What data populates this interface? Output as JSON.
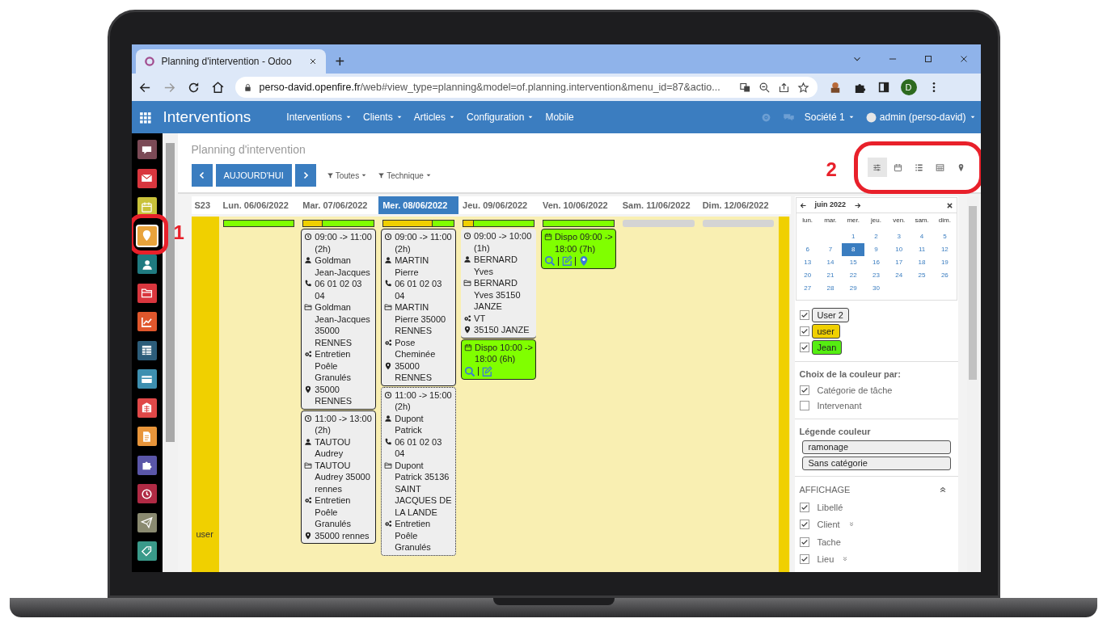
{
  "browser": {
    "tab_title": "Planning d'intervention - Odoo",
    "new_tab": "+",
    "url_host": "perso-david.openfire.fr",
    "url_path": "/web#view_type=planning&model=of.planning.intervention&menu_id=87&actio...",
    "profile_initial": "D"
  },
  "navbar": {
    "app": "Interventions",
    "menus": [
      {
        "label": "Interventions",
        "dropdown": true
      },
      {
        "label": "Clients",
        "dropdown": true
      },
      {
        "label": "Articles",
        "dropdown": true
      },
      {
        "label": "Configuration",
        "dropdown": true
      },
      {
        "label": "Mobile",
        "dropdown": false
      }
    ],
    "company": "Société 1",
    "user": "admin (perso-david)"
  },
  "apps": [
    {
      "kind": "chat",
      "color": "#7b4a56",
      "selected": false
    },
    {
      "kind": "mail",
      "color": "#d9363e",
      "selected": false
    },
    {
      "kind": "calendar",
      "color": "#c9c23a",
      "selected": false
    },
    {
      "kind": "pin",
      "color": "#e8a33c",
      "selected": true
    },
    {
      "kind": "person",
      "color": "#1f7a80",
      "selected": false
    },
    {
      "kind": "folder",
      "color": "#d9363e",
      "selected": false
    },
    {
      "kind": "chart",
      "color": "#e0572c",
      "selected": false
    },
    {
      "kind": "sheet",
      "color": "#2c5d7a",
      "selected": false
    },
    {
      "kind": "card",
      "color": "#3d8fb0",
      "selected": false
    },
    {
      "kind": "building",
      "color": "#e04848",
      "selected": false
    },
    {
      "kind": "doc",
      "color": "#e8953a",
      "selected": false
    },
    {
      "kind": "puzzle",
      "color": "#5a56a8",
      "selected": false
    },
    {
      "kind": "clock",
      "color": "#b02a44",
      "selected": false
    },
    {
      "kind": "plane",
      "color": "#8a8a70",
      "selected": false
    },
    {
      "kind": "tag",
      "color": "#3a9a8a",
      "selected": false
    }
  ],
  "page": {
    "title": "Planning d'intervention",
    "today": "AUJOURD'HUI",
    "filters": [
      "Toutes",
      "Technique"
    ],
    "views": [
      {
        "kind": "settings",
        "selected": true
      },
      {
        "kind": "calendar",
        "selected": false
      },
      {
        "kind": "list",
        "selected": false
      },
      {
        "kind": "table",
        "selected": false
      },
      {
        "kind": "map",
        "selected": false
      }
    ]
  },
  "calendar": {
    "week": "S23",
    "row_label": "user",
    "days": [
      {
        "label": "Lun. 06/06/2022",
        "selected": false,
        "load": {
          "kind": "load",
          "level": 0
        }
      },
      {
        "label": "Mar. 07/06/2022",
        "selected": false,
        "load": {
          "kind": "load",
          "level": 0.27
        },
        "events": [
          {
            "kind": "intervention",
            "lines": [
              {
                "kind": "time",
                "text": "09:00 -> 11:00 (2h)"
              },
              {
                "kind": "client",
                "text": "Goldman Jean-Jacques"
              },
              {
                "kind": "phone",
                "text": "06 01 02 03 04"
              },
              {
                "kind": "address",
                "text": "Goldman Jean-Jacques 35000 RENNES"
              },
              {
                "kind": "task",
                "text": "Entretien Poêle Granulés"
              },
              {
                "kind": "place",
                "text": "35000 RENNES"
              }
            ]
          },
          {
            "kind": "intervention",
            "lines": [
              {
                "kind": "time",
                "text": "11:00 -> 13:00 (2h)"
              },
              {
                "kind": "client",
                "text": "TAUTOU Audrey"
              },
              {
                "kind": "address",
                "text": "TAUTOU Audrey 35000 rennes"
              },
              {
                "kind": "task",
                "text": "Entretien Poêle Granulés"
              },
              {
                "kind": "place",
                "text": "35000 rennes"
              }
            ]
          }
        ]
      },
      {
        "label": "Mer. 08/06/2022",
        "selected": true,
        "load": {
          "kind": "load",
          "level": 0.7
        },
        "events": [
          {
            "kind": "intervention",
            "lines": [
              {
                "kind": "time",
                "text": "09:00 -> 11:00 (2h)"
              },
              {
                "kind": "client",
                "text": "MARTIN Pierre"
              },
              {
                "kind": "phone",
                "text": "06 01 02 03 04"
              },
              {
                "kind": "address",
                "text": "MARTIN Pierre 35000 RENNES"
              },
              {
                "kind": "task",
                "text": "Pose Cheminée"
              },
              {
                "kind": "place",
                "text": "35000 RENNES"
              }
            ]
          },
          {
            "kind": "tentative",
            "lines": [
              {
                "kind": "time",
                "text": "11:00 -> 15:00 (2h)"
              },
              {
                "kind": "client",
                "text": "Dupont Patrick"
              },
              {
                "kind": "phone",
                "text": "06 01 02 03 04"
              },
              {
                "kind": "address",
                "text": "Dupont Patrick 35136 SAINT JACQUES DE LA LANDE"
              },
              {
                "kind": "task",
                "text": "Entretien Poêle Granulés"
              }
            ]
          }
        ]
      },
      {
        "label": "Jeu. 09/06/2022",
        "selected": false,
        "load": {
          "kind": "load",
          "level": 0.15
        },
        "events": [
          {
            "kind": "unframed",
            "lines": [
              {
                "kind": "time",
                "text": "09:00 -> 10:00 (1h)"
              },
              {
                "kind": "client",
                "text": "BERNARD Yves"
              },
              {
                "kind": "address",
                "text": "BERNARD Yves 35150 JANZE"
              },
              {
                "kind": "task",
                "text": "VT"
              },
              {
                "kind": "place",
                "text": "35150 JANZE"
              }
            ]
          },
          {
            "kind": "dispo",
            "text": "Dispo 10:00 -> 18:00 (6h)",
            "actions": [
              {
                "kind": "search"
              },
              {
                "kind": "edit"
              }
            ]
          }
        ]
      },
      {
        "label": "Ven. 10/06/2022",
        "selected": false,
        "load": {
          "kind": "load",
          "level": 0
        },
        "events": [
          {
            "kind": "dispo",
            "text": "Dispo 09:00 -> 18:00 (7h)",
            "actions": [
              {
                "kind": "search"
              },
              {
                "kind": "edit"
              },
              {
                "kind": "pin"
              }
            ]
          }
        ]
      },
      {
        "label": "Sam. 11/06/2022",
        "selected": false,
        "load": {
          "kind": "empty"
        }
      },
      {
        "label": "Dim. 12/06/2022",
        "selected": false,
        "load": {
          "kind": "empty"
        }
      }
    ]
  },
  "panel": {
    "minical": {
      "month": "juin 2022",
      "weekdays": [
        "lun.",
        "mar.",
        "mer.",
        "jeu.",
        "ven.",
        "sam.",
        "dim."
      ],
      "weeks": [
        {
          "days": [
            {
              "label": "1",
              "selected": false
            },
            {
              "label": "2",
              "selected": false
            },
            {
              "label": "3",
              "selected": false
            },
            {
              "label": "4",
              "selected": false
            },
            {
              "label": "5",
              "selected": false
            }
          ]
        },
        {
          "days": [
            {
              "label": "6",
              "selected": false
            },
            {
              "label": "7",
              "selected": false
            },
            {
              "label": "8",
              "selected": true
            },
            {
              "label": "9",
              "selected": false
            },
            {
              "label": "10",
              "selected": false
            },
            {
              "label": "11",
              "selected": false
            },
            {
              "label": "12",
              "selected": false
            }
          ]
        },
        {
          "days": [
            {
              "label": "13",
              "selected": false
            },
            {
              "label": "14",
              "selected": false
            },
            {
              "label": "15",
              "selected": false
            },
            {
              "label": "16",
              "selected": false
            },
            {
              "label": "17",
              "selected": false
            },
            {
              "label": "18",
              "selected": false
            },
            {
              "label": "19",
              "selected": false
            }
          ]
        },
        {
          "days": [
            {
              "label": "20",
              "selected": false
            },
            {
              "label": "21",
              "selected": false
            },
            {
              "label": "22",
              "selected": false
            },
            {
              "label": "23",
              "selected": false
            },
            {
              "label": "24",
              "selected": false
            },
            {
              "label": "25",
              "selected": false
            },
            {
              "label": "26",
              "selected": false
            }
          ]
        },
        {
          "days": [
            {
              "label": "27",
              "selected": false
            },
            {
              "label": "28",
              "selected": false
            },
            {
              "label": "29",
              "selected": false
            },
            {
              "label": "30",
              "selected": false
            }
          ]
        }
      ]
    },
    "users": [
      {
        "label": "User 2",
        "checked": true,
        "color": "#eeeeee"
      },
      {
        "label": "user",
        "checked": true,
        "color": "#f0d000"
      },
      {
        "label": "Jean",
        "checked": true,
        "color": "#55ee11"
      }
    ],
    "color_by": {
      "title": "Choix de la couleur par:",
      "options": [
        {
          "label": "Catégorie de tâche",
          "checked": true
        },
        {
          "label": "Intervenant",
          "checked": false
        }
      ]
    },
    "legend": {
      "title": "Légende couleur",
      "items": [
        "ramonage",
        "Sans catégorie"
      ]
    },
    "display": {
      "title": "AFFICHAGE",
      "expanded": true,
      "items": [
        {
          "label": "Libellé",
          "checked": true,
          "expandable": false
        },
        {
          "label": "Client",
          "checked": true,
          "expandable": true
        },
        {
          "label": "Tache",
          "checked": true,
          "expandable": false
        },
        {
          "label": "Lieu",
          "checked": true,
          "expandable": true
        }
      ]
    }
  },
  "annotations": [
    {
      "kind": "app",
      "label": "1"
    },
    {
      "kind": "views",
      "label": "2"
    }
  ]
}
